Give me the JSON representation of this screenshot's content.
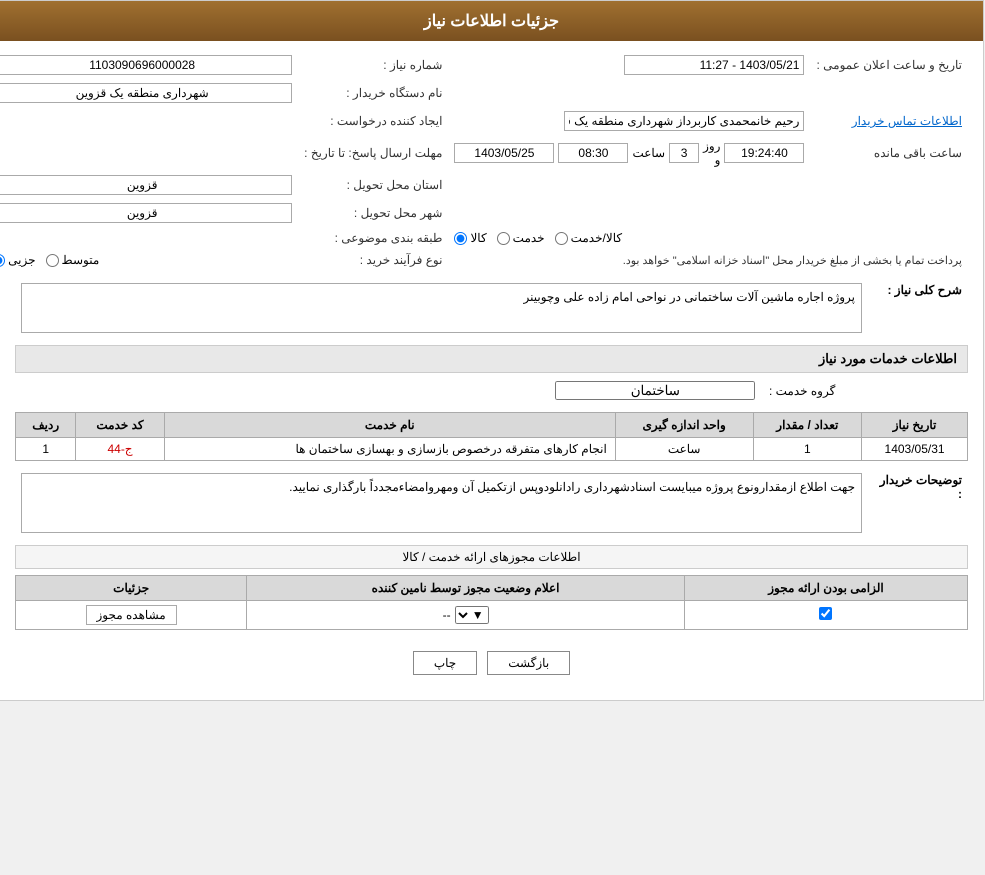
{
  "header": {
    "title": "جزئیات اطلاعات نیاز"
  },
  "fields": {
    "need_number_label": "شماره نیاز :",
    "need_number_value": "1103090696000028",
    "buyer_org_label": "نام دستگاه خریدار :",
    "buyer_org_value": "شهرداری منطقه یک قزوین",
    "requester_label": "ایجاد کننده درخواست :",
    "requester_value": "رحیم خانمحمدی کاربرداز شهرداری منطقه یک قزوین",
    "contact_link": "اطلاعات تماس خریدار",
    "announce_date_label": "تاریخ و ساعت اعلان عمومی :",
    "announce_date_value": "1403/05/21 - 11:27",
    "reply_deadline_label": "مهلت ارسال پاسخ: تا تاریخ :",
    "reply_date": "1403/05/25",
    "reply_time": "08:30",
    "reply_remaining_days": "3",
    "reply_remaining_time": "19:24:40",
    "province_label": "استان محل تحویل :",
    "province_value": "قزوین",
    "city_label": "شهر محل تحویل :",
    "city_value": "قزوین",
    "category_label": "طبقه بندی موضوعی :",
    "category_goods": "کالا",
    "category_service": "خدمت",
    "category_goods_service": "کالا/خدمت",
    "purchase_type_label": "نوع فرآیند خرید :",
    "purchase_type_partial": "جزیی",
    "purchase_type_medium": "متوسط",
    "purchase_type_note": "پرداخت تمام یا بخشی از مبلغ خریدار محل \"اسناد خزانه اسلامی\" خواهد بود.",
    "description_section": "شرح کلی نیاز :",
    "description_value": "پروژه اجاره ماشین آلات ساختمانی در نواحی امام زاده علی وچوبینر",
    "services_section": "اطلاعات خدمات مورد نیاز",
    "service_group_label": "گروه خدمت :",
    "service_group_value": "ساختمان",
    "services_table": {
      "headers": [
        "ردیف",
        "کد خدمت",
        "نام خدمت",
        "واحد اندازه گیری",
        "تعداد / مقدار",
        "تاریخ نیاز"
      ],
      "rows": [
        {
          "row": "1",
          "code": "ج-44",
          "name": "انجام کارهای متفرقه درخصوص بازسازی و بهسازی ساختمان ها",
          "unit": "ساعت",
          "quantity": "1",
          "date": "1403/05/31"
        }
      ]
    },
    "buyer_notes_label": "توضیحات خریدار :",
    "buyer_notes_value": "جهت اطلاع ازمقدارونوع پروژه میبایست اسنادشهرداری رادانلودوپس ازتکمیل آن ومهروامضاءمجدداً بارگذاری نمایید.",
    "permits_section": "اطلاعات مجوزهای ارائه خدمت / کالا",
    "permits_table": {
      "headers": [
        "الزامی بودن ارائه مجوز",
        "اعلام وضعیت مجوز توسط نامین کننده",
        "جزئیات"
      ],
      "rows": [
        {
          "mandatory": true,
          "status": "--",
          "details_label": "مشاهده مجوز"
        }
      ]
    },
    "day_label": "روز و",
    "time_label": "ساعت",
    "remaining_label": "ساعت باقی مانده"
  },
  "buttons": {
    "print": "چاپ",
    "back": "بازگشت"
  }
}
